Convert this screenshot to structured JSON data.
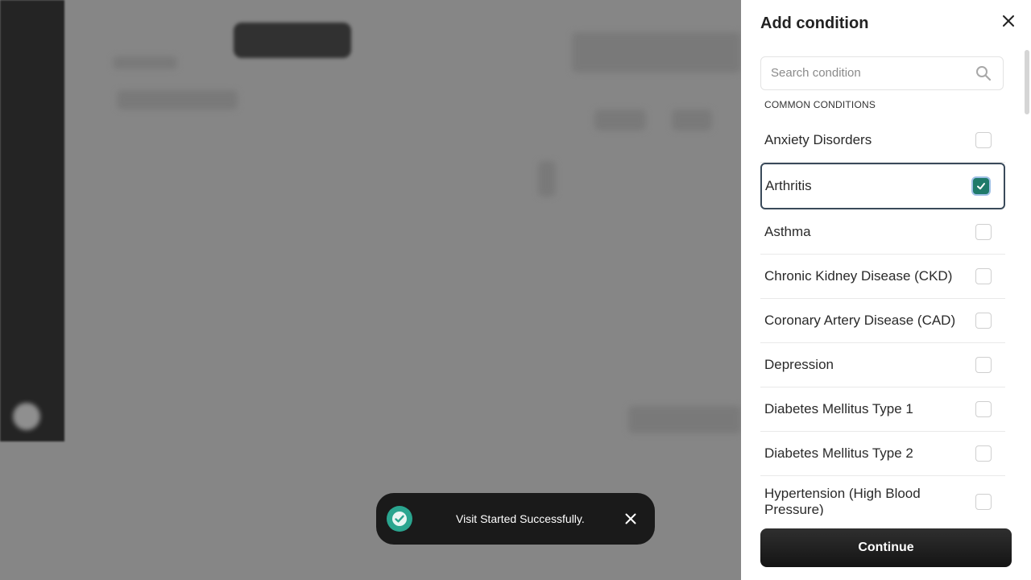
{
  "drawer": {
    "title": "Add condition",
    "search": {
      "placeholder": "Search condition",
      "value": ""
    },
    "section_label": "COMMON CONDITIONS",
    "conditions": [
      {
        "label": "Anxiety Disorders",
        "checked": false
      },
      {
        "label": "Arthritis",
        "checked": true
      },
      {
        "label": "Asthma",
        "checked": false
      },
      {
        "label": "Chronic Kidney Disease (CKD)",
        "checked": false
      },
      {
        "label": "Coronary Artery Disease (CAD)",
        "checked": false
      },
      {
        "label": "Depression",
        "checked": false
      },
      {
        "label": "Diabetes Mellitus Type 1",
        "checked": false
      },
      {
        "label": "Diabetes Mellitus Type 2",
        "checked": false
      },
      {
        "label": "Hypertension (High Blood Pressure)",
        "checked": false
      }
    ],
    "continue_label": "Continue"
  },
  "toast": {
    "message": "Visit Started Successfully."
  },
  "icons": {
    "close": "close-icon",
    "search": "search-icon",
    "check": "check-icon",
    "success": "success-check-icon"
  },
  "colors": {
    "accent": "#1f7a6a",
    "toast_bg": "#1a1a1a",
    "toast_icon": "#2aa58f",
    "continue_bg": "#1c1c1c"
  }
}
